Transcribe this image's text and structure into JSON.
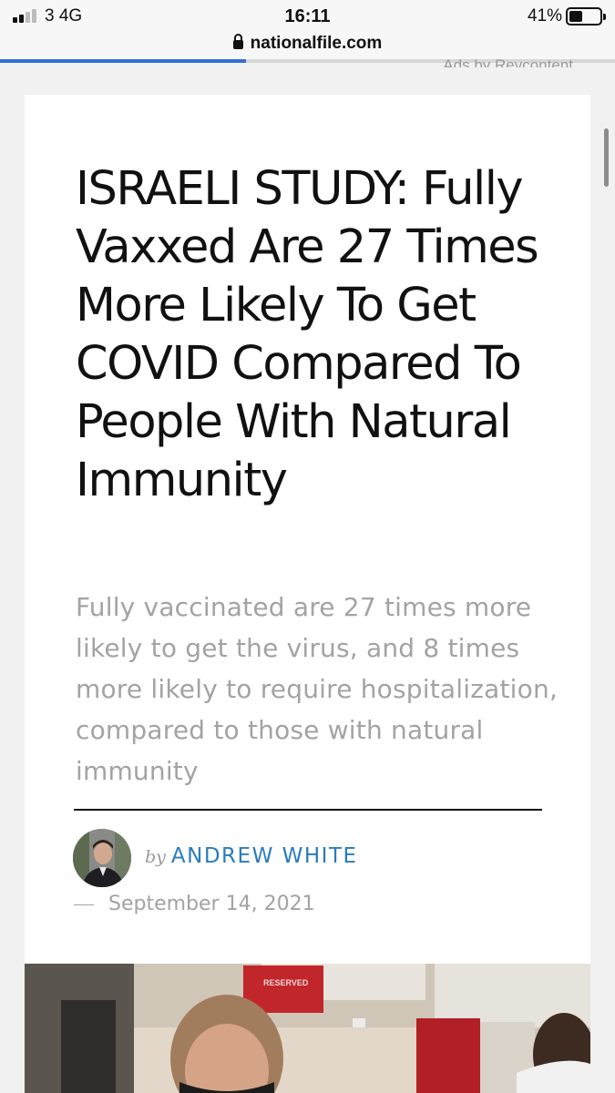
{
  "status_bar": {
    "carrier": "3  4G",
    "time": "16:11",
    "battery_percent": "41%",
    "battery_level": 0.41,
    "signal_bars_active": 2
  },
  "browser": {
    "url": "nationalfile.com",
    "load_progress": 0.4
  },
  "ads_label": "Ads by Revcontent",
  "article": {
    "headline": "ISRAELI STUDY: Fully Vaxxed Are 27 Times More Likely To Get COVID Compared To People With Natural Immunity",
    "subtitle": "Fully vaccinated are 27 times more likely to get the virus, and 8 times more likely to require hospitalization, compared to those with natural immunity",
    "by_label": "by",
    "author": "ANDREW WHITE",
    "date": "September 14, 2021",
    "photo_sign": "RESERVED"
  },
  "colors": {
    "accent": "#2f6fd6",
    "author": "#2a7bbd",
    "subtitle": "#a3a3a3"
  }
}
